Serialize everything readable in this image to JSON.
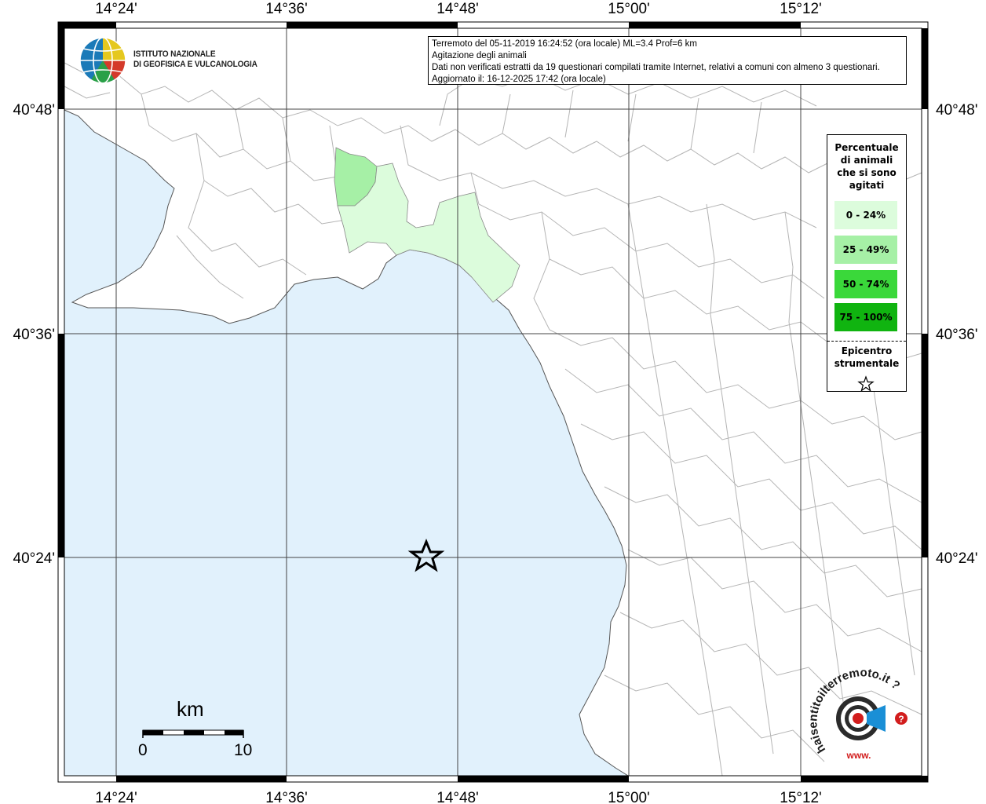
{
  "map": {
    "x_labels": [
      "14°24'",
      "14°36'",
      "14°48'",
      "15°00'",
      "15°12'"
    ],
    "y_labels": [
      "40°48'",
      "40°36'",
      "40°24'"
    ]
  },
  "info": {
    "line1": "Terremoto del 05-11-2019 16:24:52 (ora locale) ML=3.4 Prof=6 km",
    "line2": "Agitazione degli animali",
    "line3": "Dati non verificati estratti da 19 questionari compilati tramite Internet, relativi a comuni con almeno 3 questionari.",
    "line4": "Aggiornato il: 16-12-2025 17:42 (ora locale)"
  },
  "logo": {
    "line1": "ISTITUTO NAZIONALE",
    "line2": "DI GEOFISICA E VULCANOLOGIA"
  },
  "legend": {
    "title_lines": [
      "Percentuale",
      "di animali",
      "che si sono",
      "agitati"
    ],
    "items": [
      {
        "label": "0 - 24%",
        "color": "#dcfcdc"
      },
      {
        "label": "25 - 49%",
        "color": "#a6f0a6"
      },
      {
        "label": "50 - 74%",
        "color": "#3ad83a"
      },
      {
        "label": "75 - 100%",
        "color": "#10b410"
      }
    ],
    "epicenter_lines": [
      "Epicentro",
      "strumentale"
    ]
  },
  "scale": {
    "title": "km",
    "min": "0",
    "max": "10"
  },
  "site_logo": {
    "text": "haisentitoilterremoto.it ?",
    "url": "www."
  },
  "colors": {
    "sea": "#e1f1fc",
    "borders": "#b5b5b5",
    "grid": "#444444"
  }
}
